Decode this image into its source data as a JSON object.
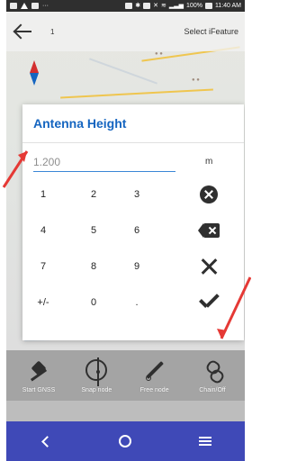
{
  "status_bar": {
    "battery_text": "100%",
    "time": "11:40 AM"
  },
  "top_bar": {
    "count_text": "1",
    "select_feature": "Select iFeature"
  },
  "dialog": {
    "title": "Antenna Height",
    "value": "1.200",
    "unit": "m",
    "keypad": [
      [
        "1",
        "2",
        "3",
        "clear-circle"
      ],
      [
        "4",
        "5",
        "6",
        "backspace"
      ],
      [
        "7",
        "8",
        "9",
        "close"
      ],
      [
        "+/-",
        "0",
        ".",
        "confirm-check"
      ]
    ]
  },
  "toolbar": {
    "items": [
      {
        "label": "Start GNSS",
        "icon": "gnss-satellite-icon"
      },
      {
        "label": "Snap node",
        "icon": "snap-node-icon"
      },
      {
        "label": "Free node",
        "icon": "free-node-pencil-icon"
      },
      {
        "label": "Chain/Off",
        "icon": "chain-icon"
      }
    ]
  },
  "nav": {
    "items": [
      "back",
      "home",
      "menu"
    ]
  },
  "colors": {
    "title_blue": "#1565c0",
    "underline_blue": "#3a86d6",
    "nav_blue": "#3f49b7",
    "annotation_red": "#e53935"
  }
}
